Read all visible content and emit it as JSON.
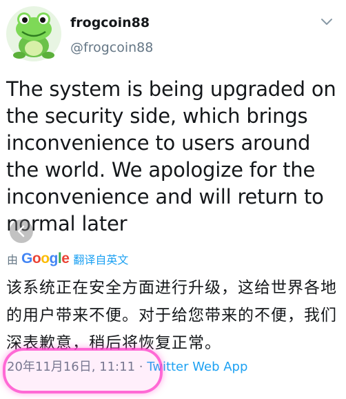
{
  "user": {
    "display_name": "frogcoin88",
    "handle": "@frogcoin88",
    "avatar_icon": "frog-avatar-icon"
  },
  "tweet": {
    "text": "The system is being upgraded on the security side, which brings inconvenience to users around the world. We apologize for the inconvenience and will return to normal later"
  },
  "translation": {
    "by_label": "由",
    "provider": "Google",
    "link_label": "翻译自英文",
    "text": "该系统正在安全方面进行升级，这给世界各地的用户带来不便。对于给您带来的不便，我们深表歉意，稍后将恢复正常。"
  },
  "meta": {
    "timestamp": "20年11月16日, 11:11",
    "separator": " · ",
    "source": "Twitter Web App"
  },
  "colors": {
    "link": "#1da1f2",
    "secondary": "#657786",
    "highlight": "#ff3cc8"
  }
}
